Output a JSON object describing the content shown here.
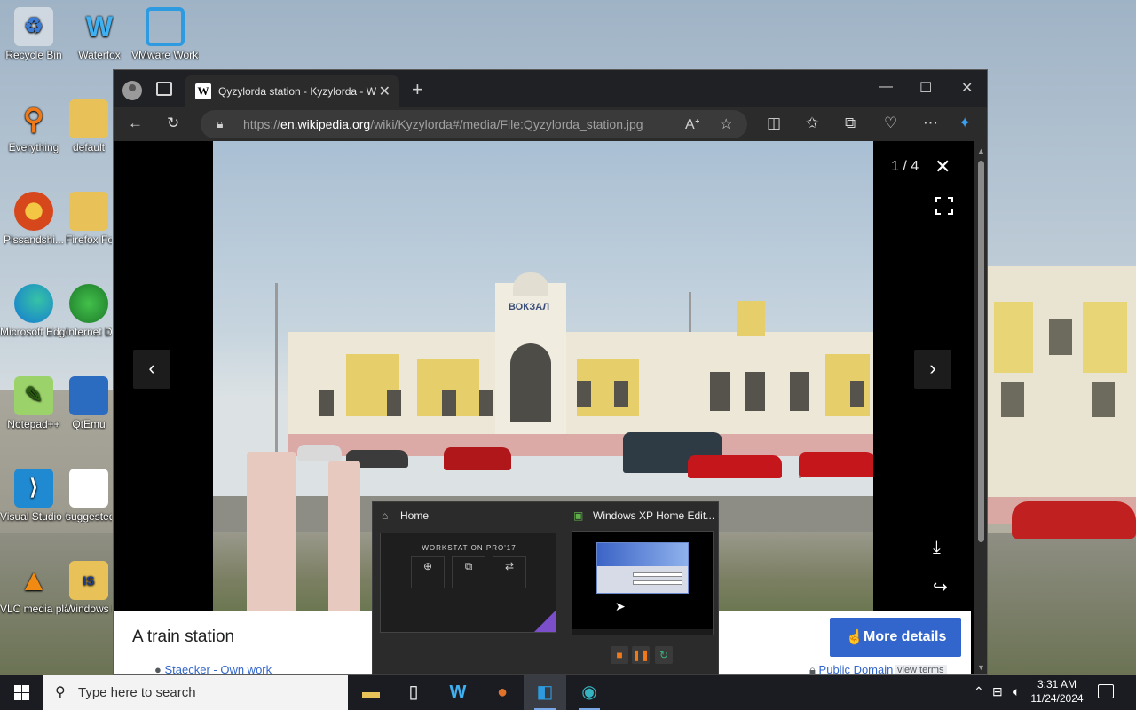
{
  "desktop": {
    "icons": [
      {
        "label": "Recycle Bin"
      },
      {
        "label": "Waterfox"
      },
      {
        "label": "VMware Workstation"
      },
      {
        "label": "Everything"
      },
      {
        "label": "default"
      },
      {
        "label": "Pissandshi..."
      },
      {
        "label": "Firefox Folder"
      },
      {
        "label": "Microsoft Edge"
      },
      {
        "label": "Internet Download..."
      },
      {
        "label": "Notepad++"
      },
      {
        "label": "QtEmu"
      },
      {
        "label": "Visual Studio Code"
      },
      {
        "label": "suggested"
      },
      {
        "label": "VLC media player"
      },
      {
        "label": "Windows LISC Li..."
      }
    ]
  },
  "browser": {
    "tab": {
      "title": "Qyzylorda station - Kyzylorda - Wikipedia",
      "favicon": "W"
    },
    "new_tab_label": "+",
    "address": {
      "url_prefix": "https://",
      "url_domain": "en.wikipedia.org",
      "url_path": "/wiki/Kyzylorda#/media/File:Qyzylorda_station.jpg"
    },
    "window_controls": {
      "minimize": "—",
      "maximize": "☐",
      "close": "✕"
    }
  },
  "media_viewer": {
    "counter": "1 / 4",
    "caption": "A train station",
    "more_details_label": "More details",
    "author": "Staecker - Own work",
    "license": "Public Domain",
    "view_terms": "view terms",
    "photo_sign": "ВОКЗАЛ"
  },
  "taskbar_preview": {
    "items": [
      {
        "title": "Home",
        "thumb_heading": "WORKSTATION PRO'17"
      },
      {
        "title": "Windows XP Home Edit..."
      }
    ]
  },
  "taskbar": {
    "search_placeholder": "Type here to search",
    "clock_time": "3:31 AM",
    "clock_date": "11/24/2024"
  },
  "colors": {
    "accent_blue": "#3366cc",
    "taskbar": "#1a1c22",
    "browser_chrome": "#202124"
  }
}
